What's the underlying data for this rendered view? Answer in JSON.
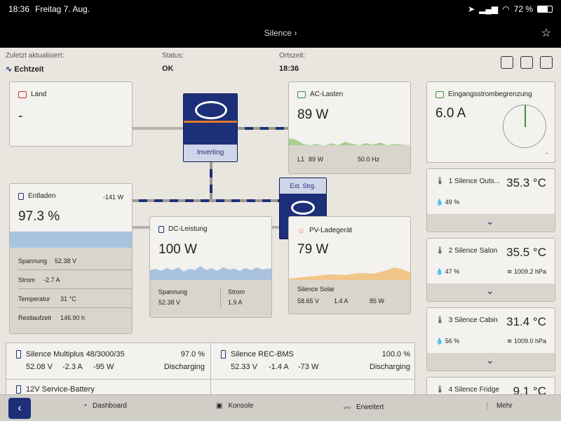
{
  "status_bar": {
    "time": "18:36",
    "date": "Freitag 7. Aug.",
    "battery": "72 %"
  },
  "title_bar": {
    "title": "Silence ›"
  },
  "info": {
    "updated_label": "Zuletzt aktualisiert:",
    "updated_value": "Echtzeit",
    "status_label": "Status:",
    "status_value": "OK",
    "localtime_label": "Ortszeit:",
    "localtime_value": "18:36"
  },
  "land": {
    "title": "Land",
    "value": "-"
  },
  "inverter": {
    "label": "Inverting"
  },
  "ac_loads": {
    "title": "AC-Lasten",
    "value": "89 W",
    "l1": "L1",
    "l1_value": "89 W",
    "freq": "50.0 Hz"
  },
  "ext_ctrl": {
    "label": "Ext. Strg."
  },
  "battery": {
    "title": "Entladen",
    "power": "-141 W",
    "percent": "97.3 %",
    "rows": [
      {
        "label": "Spannung",
        "value": "52.38 V"
      },
      {
        "label": "Strom",
        "value": "-2.7 A"
      },
      {
        "label": "Temperatur",
        "value": "31 °C"
      },
      {
        "label": "Restlaufzeit",
        "value": "146.90 h"
      }
    ]
  },
  "dc_power": {
    "title": "DC-Leistung",
    "value": "100 W",
    "voltage_label": "Spannung",
    "voltage_value": "52.38 V",
    "current_label": "Strom",
    "current_value": "1.9 A"
  },
  "pv": {
    "title": "PV-Ladegerät",
    "value": "79 W",
    "name": "Silence Solar",
    "v": "58.65 V",
    "a": "1.4 A",
    "w": "85 W"
  },
  "input_limit": {
    "title": "Eingangsstrombegrenzung",
    "value": "6.0 A",
    "dash": "-"
  },
  "sensors": [
    {
      "name": "1 Silence Outs...",
      "temp": "35.3 °C",
      "hum": "49 %",
      "pressure": ""
    },
    {
      "name": "2 Silence Salon",
      "temp": "35.5 °C",
      "hum": "47 %",
      "pressure": "1009.2 hPa"
    },
    {
      "name": "3 Silence Cabin",
      "temp": "31.4 °C",
      "hum": "56 %",
      "pressure": "1009.0 hPa"
    },
    {
      "name": "4 Silence Fridge",
      "temp": "9.1 °C"
    }
  ],
  "devices": [
    {
      "name": "Silence Multiplus 48/3000/35",
      "percent": "97.0 %",
      "v": "52.08 V",
      "a": "-2.3 A",
      "w": "-95 W",
      "state": "Discharging"
    },
    {
      "name": "Silence REC-BMS",
      "percent": "100.0 %",
      "v": "52.33 V",
      "a": "-1.4 A",
      "w": "-73 W",
      "state": "Discharging"
    },
    {
      "name": "12V Service-Battery"
    }
  ],
  "nav": {
    "dashboard": "Dashboard",
    "console": "Konsole",
    "advanced": "Erweitert",
    "more": "Mehr"
  },
  "colors": {
    "brand_blue": "#1d2f78",
    "ac_green": "#a9cf8f",
    "battery_blue": "#a9c3df",
    "pv_orange": "#f0c68a"
  }
}
